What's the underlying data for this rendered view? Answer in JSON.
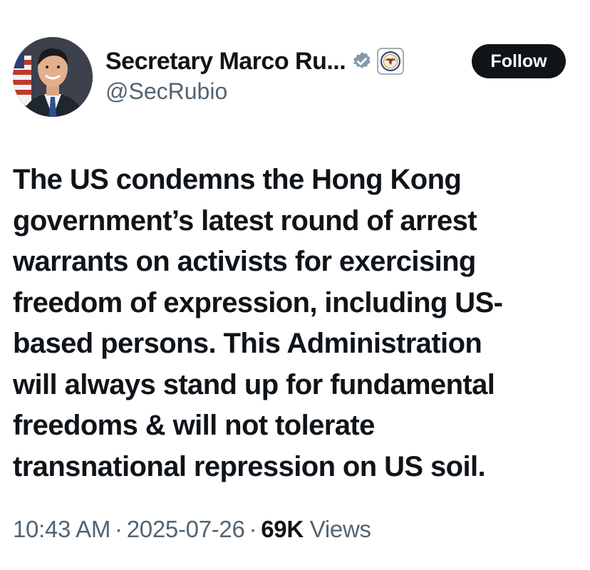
{
  "author": {
    "display_name": "Secretary Marco Ru...",
    "handle": "@SecRubio"
  },
  "icons": {
    "verified": "verified-badge-icon",
    "affiliate": "state-department-seal-icon",
    "avatar": "profile-photo"
  },
  "follow_label": "Follow",
  "tweet_lines": [
    "The US condemns the Hong Kong",
    "government’s latest round of arrest",
    "warrants on activists for exercising",
    "freedom of expression, including US-",
    "based persons. This Administration",
    "will always stand up for fundamental",
    "freedoms & will not tolerate",
    "transnational repression on US soil."
  ],
  "meta": {
    "time": "10:43 AM",
    "date": "2025-07-26",
    "views_count": "69K",
    "views_label": "Views",
    "separator": "·"
  },
  "colors": {
    "text": "#0f1419",
    "secondary": "#536471",
    "verified_badge": "#829aab",
    "button_bg": "#0f1419",
    "button_text": "#ffffff"
  }
}
